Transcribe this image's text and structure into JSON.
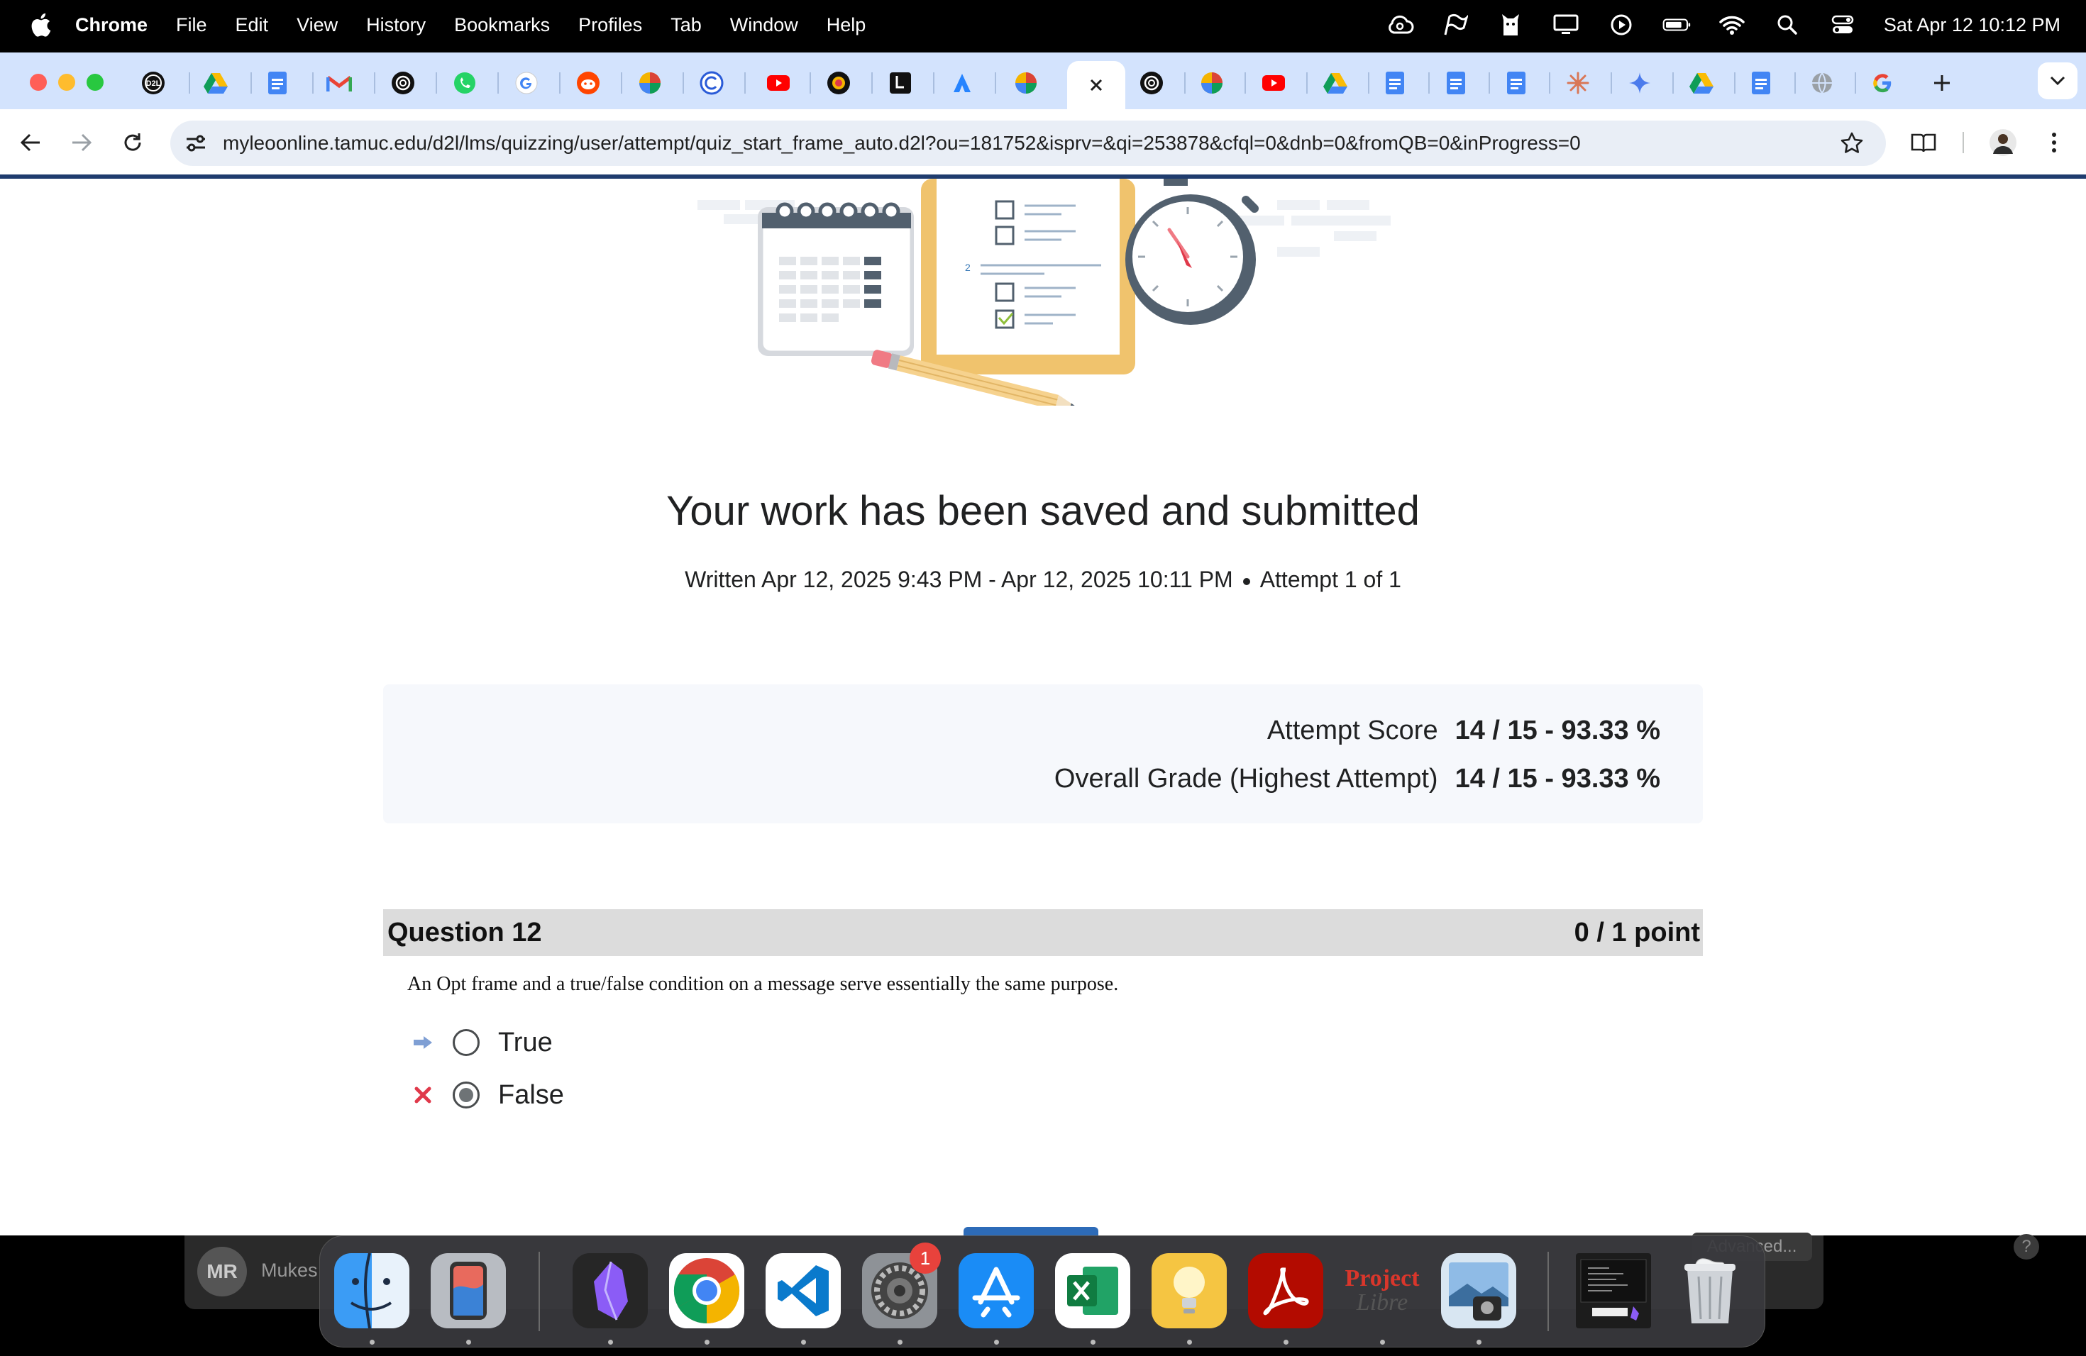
{
  "menubar": {
    "app_name": "Chrome",
    "items": [
      "File",
      "Edit",
      "View",
      "History",
      "Bookmarks",
      "Profiles",
      "Tab",
      "Window",
      "Help"
    ],
    "clock": "Sat Apr 12  10:12 PM"
  },
  "browser": {
    "url": "myleoonline.tamuc.edu/d2l/lms/quizzing/user/attempt/quiz_start_frame_auto.d2l?ou=181752&isprv=&qi=253878&cfql=0&dnb=0&fromQB=0&inProgress=0"
  },
  "page": {
    "title": "Your work has been saved and submitted",
    "written": "Written Apr 12, 2025 9:43 PM - Apr 12, 2025 10:11 PM",
    "attempt": "Attempt 1 of 1",
    "scores": {
      "attempt_label": "Attempt Score",
      "attempt_value": "14 / 15 - 93.33 %",
      "overall_label": "Overall Grade (Highest Attempt)",
      "overall_value": "14 / 15 - 93.33 %"
    },
    "question": {
      "title": "Question 12",
      "points": "0 / 1 point",
      "text": "An Opt frame and a true/false condition on a message serve essentially the same purpose.",
      "options": [
        {
          "label": "True",
          "selected": false,
          "indicator": "correct-answer-arrow"
        },
        {
          "label": "False",
          "selected": true,
          "indicator": "incorrect-x"
        }
      ]
    }
  },
  "dock": {
    "behind_window_initials": "MR",
    "behind_window_name": "Mukes",
    "advanced_button": "Advanced...",
    "help_button": "?",
    "settings_badge": "1",
    "project_libre_word1": "Project",
    "project_libre_word2": "Libre"
  },
  "colors": {
    "tab_strip": "#d3e3fd",
    "omnibox": "#e9eef6",
    "question_header": "#dcdcdc",
    "score_card": "#f6f8fc",
    "incorrect_red": "#e0394a",
    "arrow_blue": "#7f9fd4"
  }
}
